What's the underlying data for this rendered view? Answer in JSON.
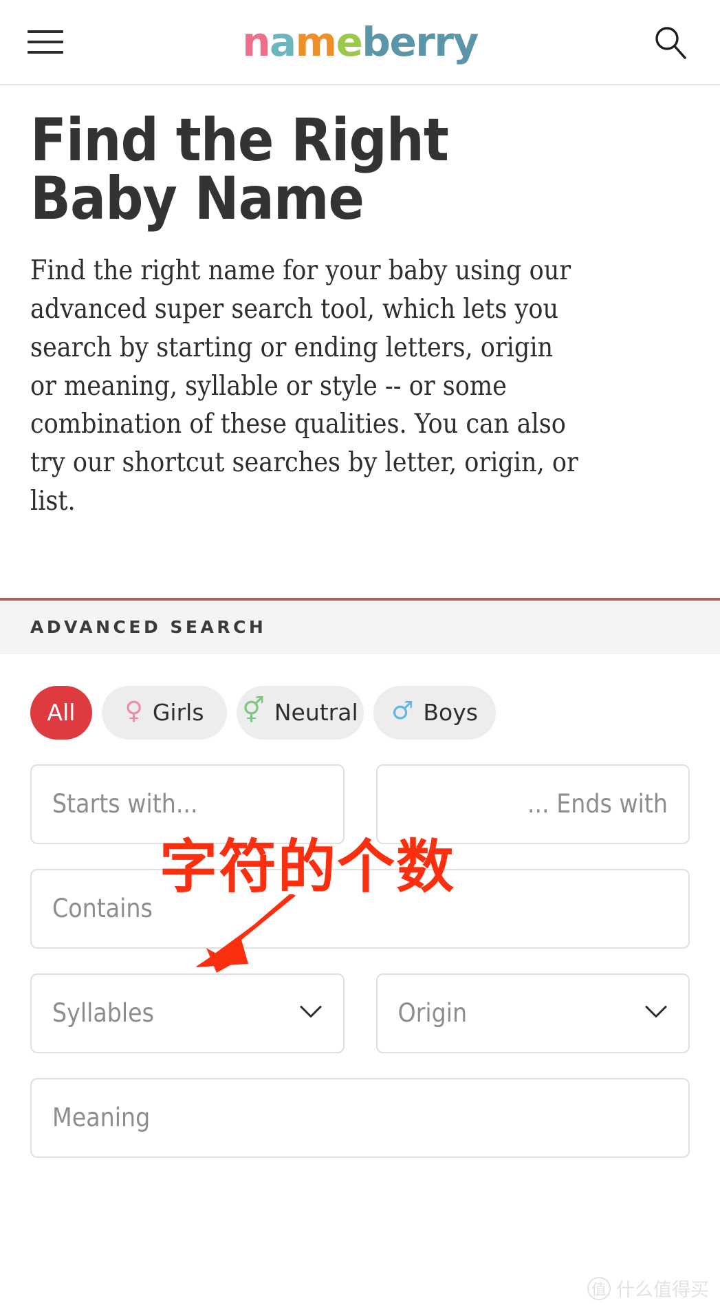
{
  "header": {
    "menu_icon": "hamburger-menu-icon",
    "search_icon": "search-icon",
    "logo": {
      "full_text": "nameberry",
      "letters": [
        {
          "ch": "n",
          "color": "#ef6e8a"
        },
        {
          "ch": "a",
          "color": "#6bb6bf"
        },
        {
          "ch": "m",
          "color": "#ef8f2a"
        },
        {
          "ch": "e",
          "color": "#9dc94a"
        },
        {
          "ch": "b",
          "color": "#5a96a8"
        },
        {
          "ch": "e",
          "color": "#5a96a8"
        },
        {
          "ch": "r",
          "color": "#5a96a8"
        },
        {
          "ch": "r",
          "color": "#5a96a8"
        },
        {
          "ch": "y",
          "color": "#5a96a8"
        }
      ]
    }
  },
  "hero": {
    "title": "Find the Right Baby Name",
    "description": "Find the right name for your baby using our advanced super search tool, which lets you search by starting or ending letters, origin or meaning, syllable or style -- or some combination of these qualities. You can also try our shortcut searches by letter, origin, or list."
  },
  "advanced_search": {
    "section_label": "ADVANCED SEARCH",
    "accent_border_color": "#b0605c",
    "bar_background": "#f4f4f4",
    "gender_filters": [
      {
        "label": "All",
        "symbol": "",
        "symbol_name": "none",
        "selected": true,
        "color": "#dd3b3f"
      },
      {
        "label": "Girls",
        "symbol": "♀",
        "symbol_name": "venus-female-icon",
        "selected": false,
        "color": "#ef8aa8"
      },
      {
        "label": "Neutral",
        "symbol": "⚥",
        "symbol_name": "male-female-neutral-icon",
        "selected": false,
        "color": "#7cc47f"
      },
      {
        "label": "Boys",
        "symbol": "♂",
        "symbol_name": "mars-male-icon",
        "selected": false,
        "color": "#5fb6e3"
      }
    ],
    "fields": {
      "starts_with": {
        "placeholder": "Starts with...",
        "value": ""
      },
      "ends_with": {
        "placeholder": "... Ends with",
        "value": ""
      },
      "contains": {
        "placeholder": "Contains",
        "value": ""
      },
      "syllables": {
        "placeholder": "Syllables",
        "value": "",
        "chevron": "chevron-down-icon"
      },
      "origin": {
        "placeholder": "Origin",
        "value": "",
        "chevron": "chevron-down-icon"
      },
      "meaning": {
        "placeholder": "Meaning",
        "value": ""
      }
    }
  },
  "annotation": {
    "text": "字符的个数",
    "color": "#fa2f10",
    "arrow": "red-arrow-pointing-to-syllables"
  },
  "watermark": {
    "badge": "值",
    "text": "什么值得买"
  }
}
